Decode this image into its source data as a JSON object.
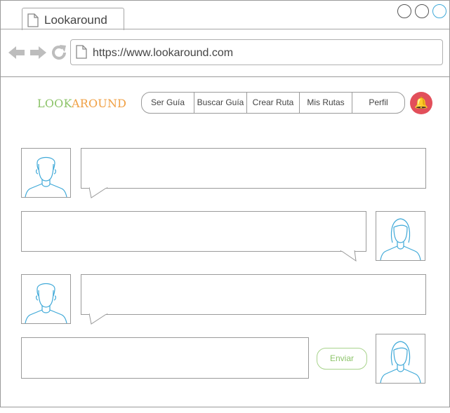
{
  "browser": {
    "tab_title": "Lookaround",
    "url": "https://www.lookaround.com",
    "window_buttons": [
      "minimize",
      "maximize",
      "close"
    ],
    "close_button_color": "#3fa9d8"
  },
  "header": {
    "logo_part1": "LOOK",
    "logo_part2": "AROUND",
    "logo_colors": [
      "#8dc46a",
      "#f0a044"
    ],
    "nav": [
      "Ser Guía",
      "Buscar Guía",
      "Crear Ruta",
      "Mis Rutas",
      "Perfil"
    ],
    "notification_icon": "bell-icon",
    "notification_color": "#e24f5a"
  },
  "chat": {
    "messages": [
      {
        "sender": "male",
        "side": "left",
        "text": ""
      },
      {
        "sender": "female",
        "side": "right",
        "text": ""
      },
      {
        "sender": "male",
        "side": "left",
        "text": ""
      }
    ],
    "input": {
      "value": "",
      "placeholder": ""
    },
    "send_label": "Enviar",
    "avatar_line_color": "#3fa9d8"
  }
}
